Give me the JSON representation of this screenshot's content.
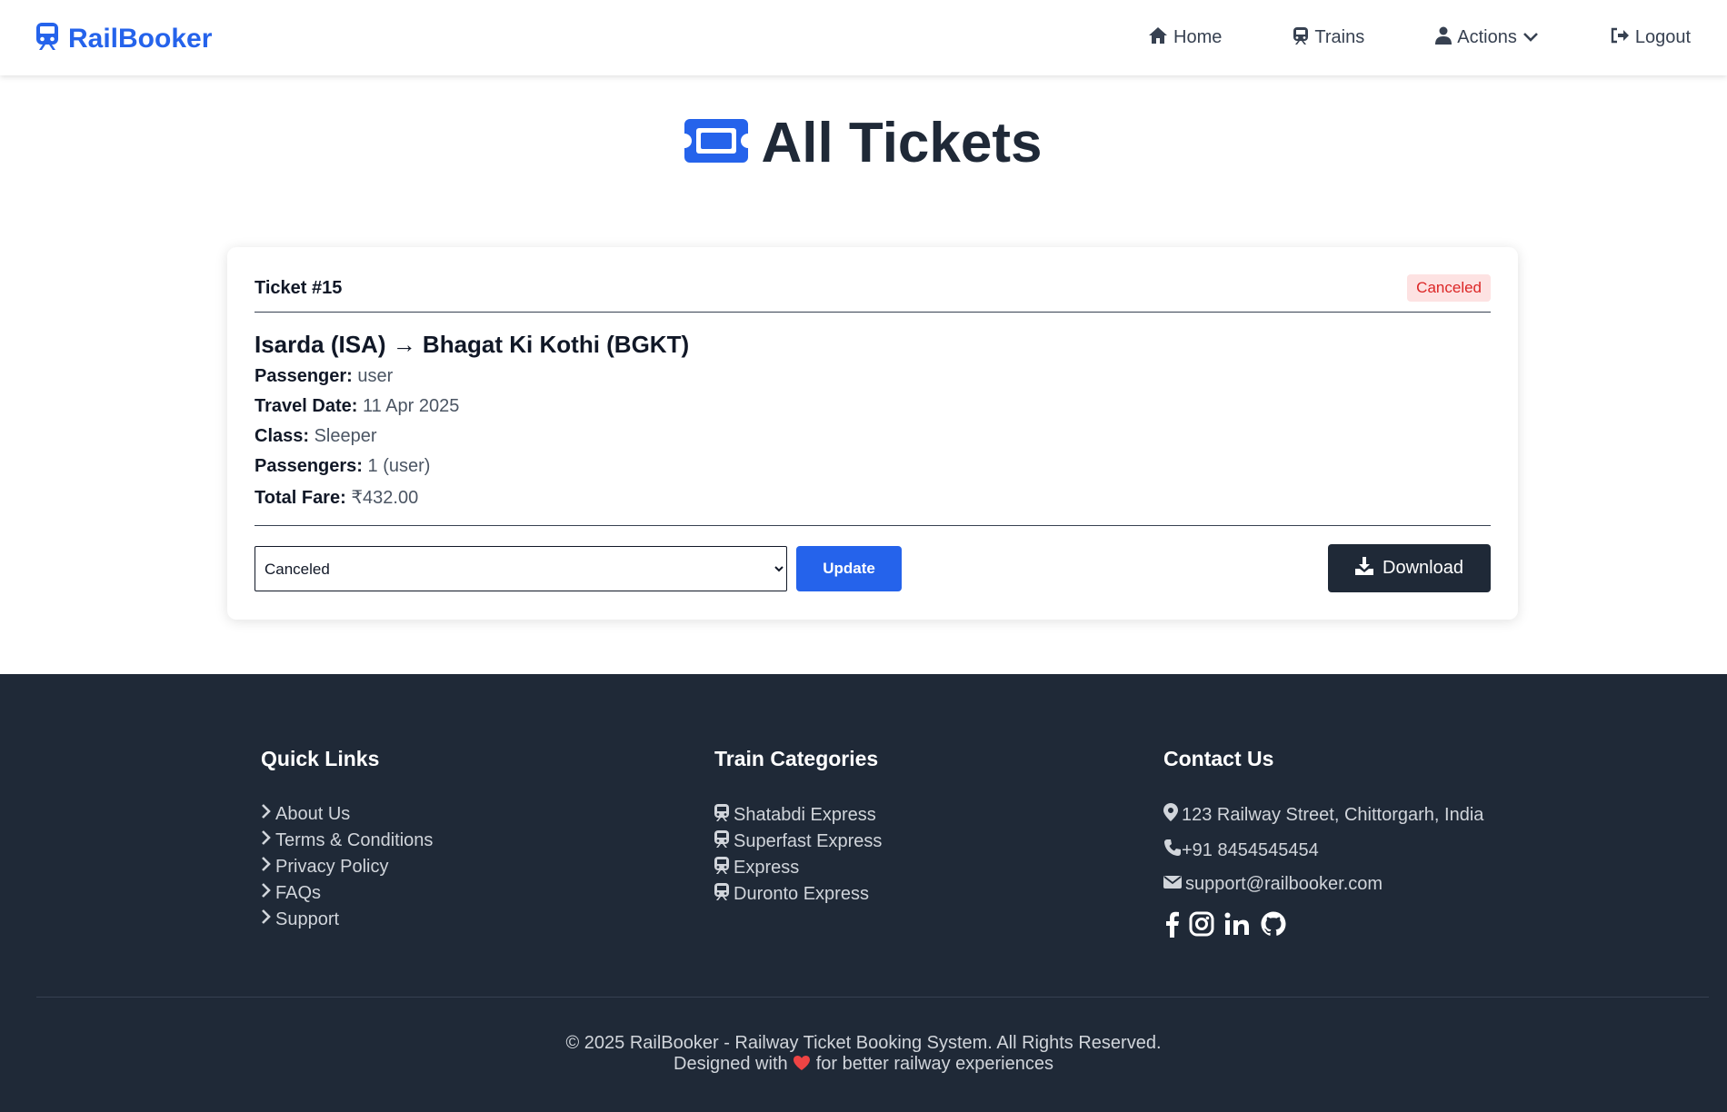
{
  "navbar": {
    "brand": "RailBooker",
    "links": [
      {
        "label": "Home",
        "icon": "home-icon"
      },
      {
        "label": "Trains",
        "icon": "train-icon"
      },
      {
        "label": "Actions",
        "icon": "user-icon"
      },
      {
        "label": "Logout",
        "icon": "logout-icon"
      }
    ]
  },
  "page": {
    "title": "All Tickets",
    "title_icon": "ticket-icon"
  },
  "ticket": {
    "id_label": "Ticket #15",
    "status_badge": "Canceled",
    "route": "Isarda (ISA) → Bhagat Ki Kothi (BGKT)",
    "details": [
      {
        "label": "Passenger:",
        "value": "user"
      },
      {
        "label": "Travel Date:",
        "value": "11 Apr 2025"
      },
      {
        "label": "Class:",
        "value": "Sleeper"
      },
      {
        "label": "Passengers:",
        "value": "1 (user)"
      },
      {
        "label": "Total Fare:",
        "value": "₹432.00"
      }
    ],
    "status_select_value": "Canceled",
    "update_label": "Update",
    "download_label": "Download"
  },
  "footer": {
    "quick_links": {
      "heading": "Quick Links",
      "items": [
        "About Us",
        "Terms & Conditions",
        "Privacy Policy",
        "FAQs",
        "Support"
      ]
    },
    "train_categories": {
      "heading": "Train Categories",
      "items": [
        "Shatabdi Express",
        "Superfast Express",
        "Express",
        "Duronto Express"
      ]
    },
    "contact": {
      "heading": "Contact Us",
      "address": "123 Railway Street, Chittorgarh, India",
      "phone": "+91 8454545454",
      "email": "support@railbooker.com",
      "social": [
        "facebook-icon",
        "instagram-icon",
        "linkedin-icon",
        "github-icon"
      ]
    },
    "copyright_line1": "© 2025 RailBooker - Railway Ticket Booking System. All Rights Reserved.",
    "copyright_pre": "Designed with",
    "copyright_post": "for better railway experiences"
  },
  "colors": {
    "accent": "#2563eb",
    "dark": "#1f2937",
    "danger": "#dc2626"
  }
}
